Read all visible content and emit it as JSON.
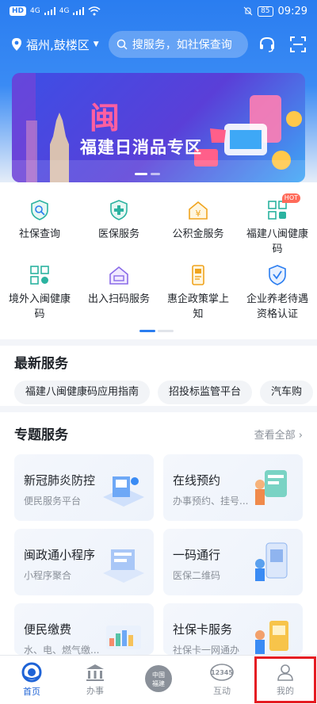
{
  "status_bar": {
    "network": "HD",
    "signal1": "4G",
    "signal2": "4G",
    "battery": "85",
    "time": "09:29"
  },
  "header": {
    "location": "福州,鼓楼区",
    "search_placeholder": "搜服务，如社保查询"
  },
  "banner": {
    "logo_text": "闽",
    "title": "福建日消品专区"
  },
  "services": [
    {
      "label": "社保查询",
      "icon": "shield-search-icon"
    },
    {
      "label": "医保服务",
      "icon": "medical-shield-icon"
    },
    {
      "label": "公积金服务",
      "icon": "yen-house-icon"
    },
    {
      "label": "福建八闽健康码",
      "icon": "qr-health-icon",
      "badge": "HOT"
    },
    {
      "label": "境外入闽健康码",
      "icon": "qr-globe-icon"
    },
    {
      "label": "出入扫码服务",
      "icon": "house-scan-icon"
    },
    {
      "label": "惠企政策掌上知",
      "icon": "phone-policy-icon"
    },
    {
      "label": "企业养老待遇资格认证",
      "icon": "shield-verify-icon"
    }
  ],
  "latest": {
    "title": "最新服务",
    "items": [
      "福建八闽健康码应用指南",
      "招投标监管平台",
      "汽车购"
    ]
  },
  "topics": {
    "title": "专题服务",
    "more": "查看全部",
    "cards": [
      {
        "title": "新冠肺炎防控",
        "subtitle": "便民服务平台"
      },
      {
        "title": "在线预约",
        "subtitle": "办事预约、挂号..."
      },
      {
        "title": "闽政通小程序",
        "subtitle": "小程序聚合"
      },
      {
        "title": "一码通行",
        "subtitle": "医保二维码"
      },
      {
        "title": "便民缴费",
        "subtitle": "水、电、燃气缴..."
      },
      {
        "title": "社保卡服务",
        "subtitle": "社保卡一网通办"
      }
    ]
  },
  "tabbar": [
    {
      "label": "首页",
      "icon": "home-eye-icon"
    },
    {
      "label": "办事",
      "icon": "building-icon"
    },
    {
      "label": "",
      "icon": "china-fujian-seal-icon",
      "seal_text": "中国福建"
    },
    {
      "label": "互动",
      "icon": "hotline-12345-icon",
      "badge": "12345"
    },
    {
      "label": "我的",
      "icon": "user-icon"
    }
  ],
  "colors": {
    "brand": "#2a7df0",
    "active": "#1e63d6",
    "highlight_box": "#e51c23"
  }
}
